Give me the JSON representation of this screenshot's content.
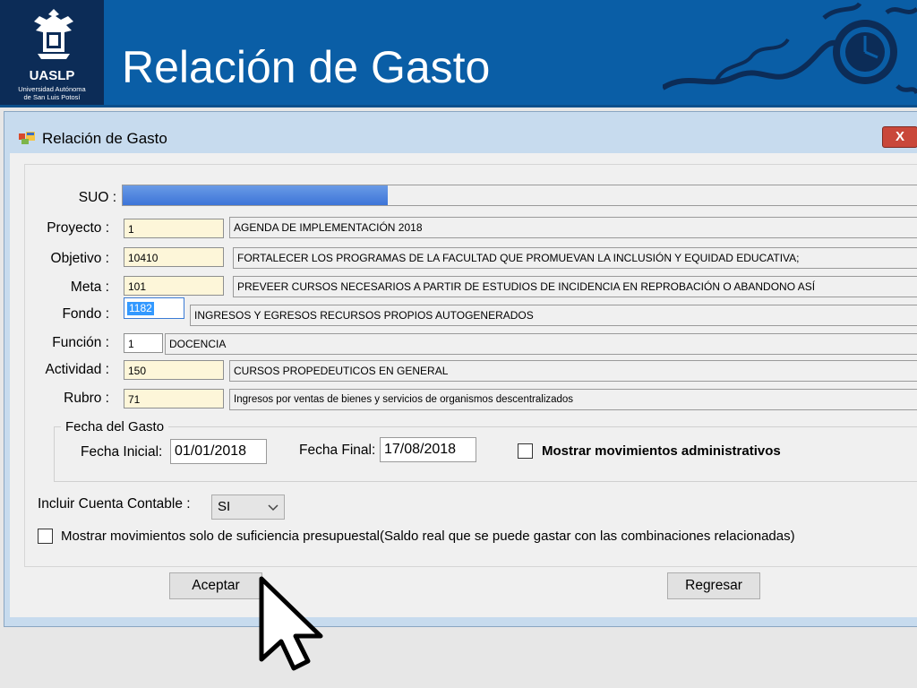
{
  "header": {
    "org_short": "UASLP",
    "org_line1": "Universidad Autónoma",
    "org_line2": "de San Luis Potosí",
    "slide_title": "Relación de Gasto"
  },
  "window": {
    "title": "Relación de Gasto",
    "close_label": "X"
  },
  "form": {
    "suo_label": "SUO :",
    "rows": [
      {
        "label": "Proyecto :",
        "code": "1",
        "description": "AGENDA DE IMPLEMENTACIÓN 2018"
      },
      {
        "label": "Objetivo :",
        "code": "10410",
        "description": "FORTALECER LOS PROGRAMAS  DE LA FACULTAD QUE PROMUEVAN LA INCLUSIÓN Y EQUIDAD EDUCATIVA;"
      },
      {
        "label": "Meta :",
        "code": "101",
        "description": "PREVEER CURSOS NECESARIOS A PARTIR DE ESTUDIOS DE INCIDENCIA EN REPROBACIÓN O ABANDONO ASÍ"
      },
      {
        "label": "Fondo :",
        "code": "1182",
        "description": "INGRESOS Y EGRESOS RECURSOS PROPIOS AUTOGENERADOS"
      },
      {
        "label": "Función :",
        "code": "1",
        "description": "DOCENCIA"
      },
      {
        "label": "Actividad :",
        "code": "150",
        "description": "CURSOS PROPEDEUTICOS EN GENERAL"
      },
      {
        "label": "Rubro :",
        "code": "71",
        "description": "Ingresos por ventas de bienes y servicios de organismos descentralizados"
      }
    ]
  },
  "fecha": {
    "legend": "Fecha del Gasto",
    "inicial_label": "Fecha Inicial:",
    "inicial_value": "01/01/2018",
    "final_label": "Fecha Final:",
    "final_value": "17/08/2018",
    "admin_label": "Mostrar movimientos administrativos",
    "admin_checked": false
  },
  "cuenta": {
    "label": "Incluir Cuenta Contable :",
    "value": "SI"
  },
  "suficiencia": {
    "label": "Mostrar movimientos solo de suficiencia presupuestal(Saldo real que se puede gastar con las combinaciones relacionadas)",
    "checked": false
  },
  "buttons": {
    "accept": "Aceptar",
    "back": "Regresar"
  },
  "colors": {
    "banner": "#0a5ea6",
    "logo_bg": "#0c2c57",
    "field_bg": "#fdf6d9",
    "selection": "#3399ff"
  }
}
